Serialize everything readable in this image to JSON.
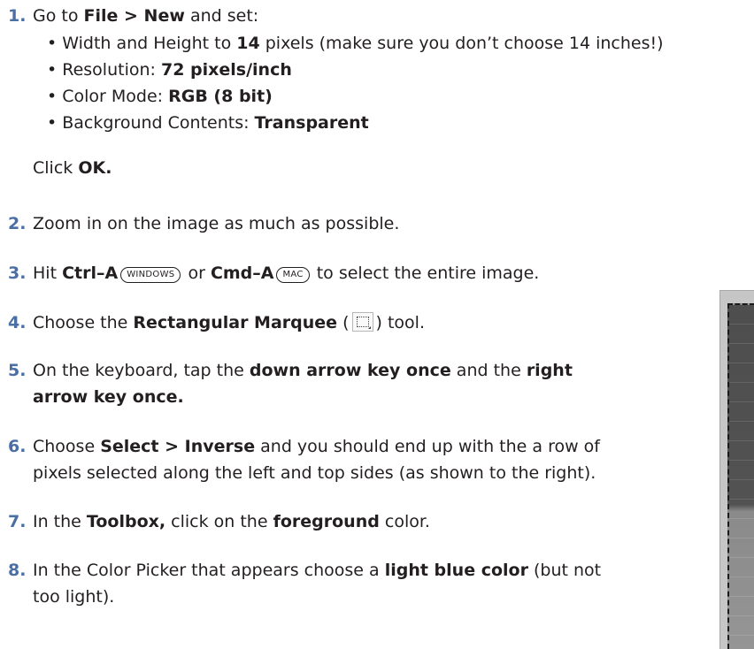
{
  "steps": {
    "s1": {
      "num": "1.",
      "t1": "Go to ",
      "b1": "File > New",
      "t2": " and set:",
      "bullets": [
        {
          "pre": "• Width and Height to ",
          "bold": "14",
          "post": " pixels (make sure you don’t choose 14 inches!)"
        },
        {
          "pre": "• Resolution: ",
          "bold": "72 pixels/inch",
          "post": ""
        },
        {
          "pre": "• Color Mode: ",
          "bold": "RGB (8 bit)",
          "post": ""
        },
        {
          "pre": "• Background Contents: ",
          "bold": "Transparent",
          "post": ""
        }
      ],
      "click_pre": "Click ",
      "click_bold": "OK."
    },
    "s2": {
      "num": "2.",
      "text": "Zoom in on the image as much as possible."
    },
    "s3": {
      "num": "3.",
      "t1": "Hit ",
      "b1": "Ctrl–A",
      "k1": "WINDOWS",
      "t2": " or ",
      "b2": "Cmd–A",
      "k2": "MAC",
      "t3": " to select the entire image."
    },
    "s4": {
      "num": "4.",
      "t1": "Choose the ",
      "b1": "Rectangular Marquee",
      "t2": " (",
      "t3": ") tool."
    },
    "s5": {
      "num": "5.",
      "t1": "On the keyboard, tap the ",
      "b1": "down arrow key once",
      "t2": " and the ",
      "b2": "right",
      "b3": "arrow key once."
    },
    "s6": {
      "num": "6.",
      "t1": "Choose ",
      "b1": "Select > Inverse",
      "t2": " and you should end up with the a row of",
      "line2": "pixels selected along the left and top sides (as shown to the right)."
    },
    "s7": {
      "num": "7.",
      "t1": "In the ",
      "b1": "Toolbox,",
      "t2": " click on the ",
      "b2": "foreground",
      "t3": " color."
    },
    "s8": {
      "num": "8.",
      "t1": "In the Color Picker that appears choose a ",
      "b1": "light blue color",
      "t2": " (but not",
      "line2": "too light)."
    }
  }
}
